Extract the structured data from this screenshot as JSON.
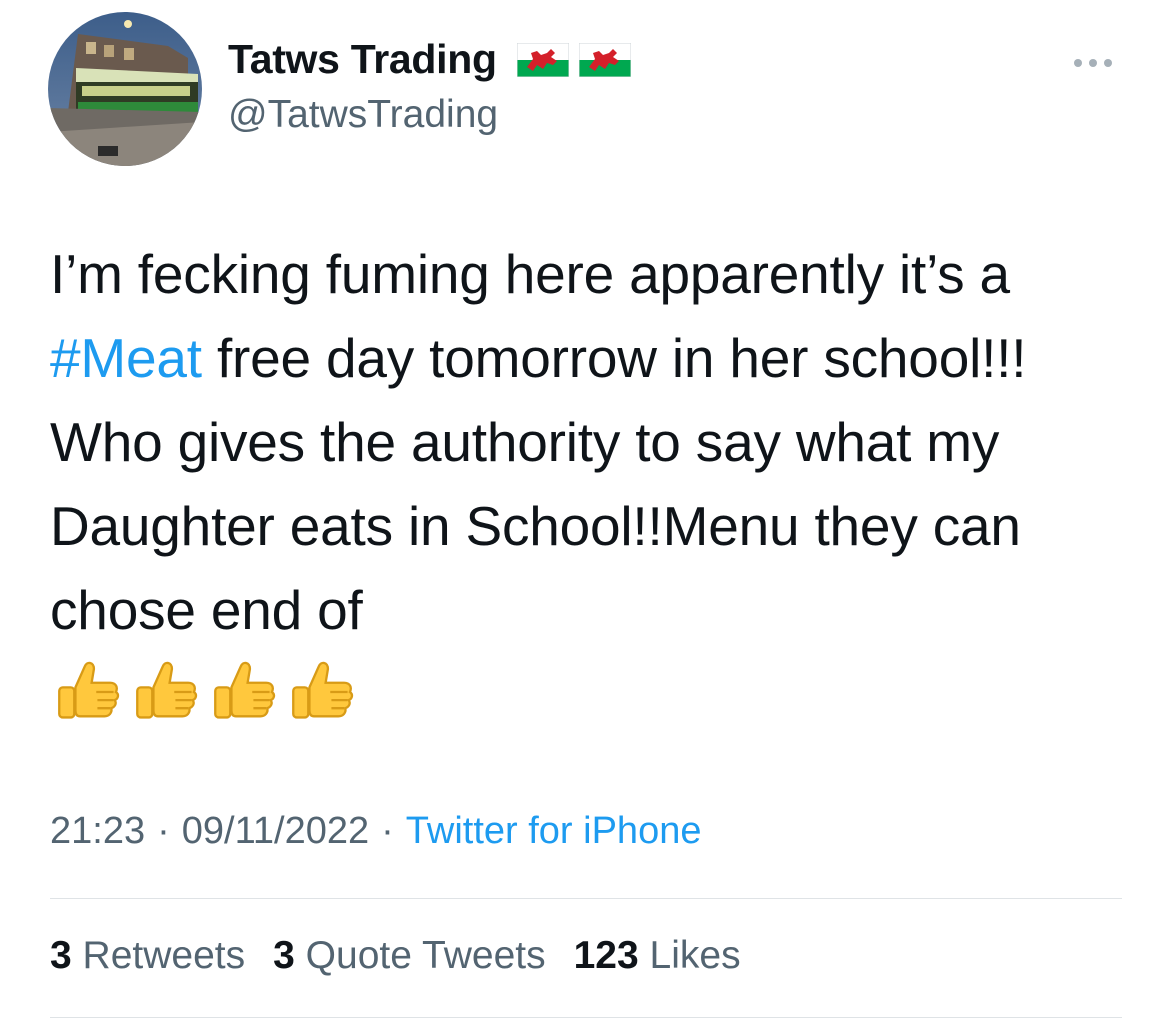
{
  "author": {
    "display_name": "Tatws Trading",
    "handle": "@TatwsTrading",
    "flag_icons": [
      "wales-flag-icon",
      "wales-flag-icon"
    ]
  },
  "tweet": {
    "text_before": "I’m fecking fuming here apparently it’s a ",
    "hashtag": "#Meat",
    "text_after": " free day tomorrow in her school!!! Who gives the authority to say what my Daughter eats in School!!Menu they can chose end of",
    "emojis": [
      "thumbs-up-icon",
      "thumbs-up-icon",
      "thumbs-up-icon",
      "thumbs-up-icon"
    ]
  },
  "meta": {
    "time": "21:23",
    "separator": "·",
    "date": "09/11/2022",
    "source": "Twitter for iPhone"
  },
  "stats": {
    "retweets_count": "3",
    "retweets_label": "Retweets",
    "quotes_count": "3",
    "quotes_label": "Quote Tweets",
    "likes_count": "123",
    "likes_label": "Likes"
  },
  "colors": {
    "text": "#0f1419",
    "secondary": "#536471",
    "link": "#1d9bf0",
    "divider": "#dfe3e6"
  }
}
